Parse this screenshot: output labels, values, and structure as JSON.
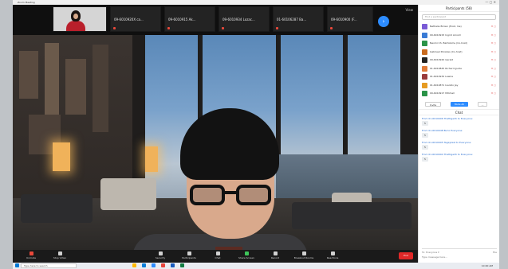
{
  "window": {
    "title": "Zoom Meeting",
    "controls": "— ▢ ✕"
  },
  "thumbnails": [
    {
      "name": ""
    },
    {
      "name": "09-6010920X ca..."
    },
    {
      "name": "09-6010915 Ak..."
    },
    {
      "name": "09-6010934 Lozac..."
    },
    {
      "name": "01-60106287 Ba..."
    },
    {
      "name": "09-6010900 (F..."
    }
  ],
  "view_label": "View",
  "toolbar": {
    "items": [
      {
        "label": "Unmute",
        "icon": "microphone-icon"
      },
      {
        "label": "Stop Video",
        "icon": "video-icon"
      },
      {
        "label": "Security",
        "icon": "shield-icon"
      },
      {
        "label": "Participants",
        "icon": "participants-icon"
      },
      {
        "label": "Chat",
        "icon": "chat-icon"
      },
      {
        "label": "Share Screen",
        "icon": "share-screen-icon"
      },
      {
        "label": "Record",
        "icon": "record-icon"
      },
      {
        "label": "Breakout Rooms",
        "icon": "breakout-rooms-icon"
      },
      {
        "label": "Reactions",
        "icon": "reactions-icon"
      }
    ],
    "end_label": "End"
  },
  "participants_panel": {
    "title": "Participants (58)",
    "search_placeholder": "Find a participant",
    "rows": [
      {
        "name": "Nathalie Brown (Host, me)",
        "status": "✕ ▢",
        "color": "#7a5bd6"
      },
      {
        "name": "09-6010915 Ingrid Arnold",
        "status": "✕ ▢",
        "color": "#3a7bd5"
      },
      {
        "name": "Naomi Ch. Bartolome (Co-host)",
        "status": "✕ ▢",
        "color": "#2b9348"
      },
      {
        "name": "Gabrieel Ponsiles (Co-host)",
        "status": "✕ ▢",
        "color": "#c96b1f"
      },
      {
        "name": "09-6010920 Gerald",
        "status": "✕ ▢",
        "color": "#222222"
      },
      {
        "name": "01-6010845 Richard guide",
        "status": "✕ ▢",
        "color": "#e07b39"
      },
      {
        "name": "01-6010932 Lawrie",
        "status": "✕ ▢",
        "color": "#9a3b3b"
      },
      {
        "name": "01-6010871 Ivanillo Jay",
        "status": "✕ ▢",
        "color": "#e69b22"
      },
      {
        "name": "09-6010917 Mitchell",
        "status": "✕ ▢",
        "color": "#2b9348"
      }
    ],
    "invite_label": "Invite",
    "mute_all_label": "Mute All",
    "more_label": "..."
  },
  "chat_panel": {
    "title": "Chat",
    "messages": [
      {
        "from": "From 01-6010906 Thattigadh to Everyone:",
        "text": "5"
      },
      {
        "from": "From 01-6010948 Bs to Everyone:",
        "text": "5"
      },
      {
        "from": "From 01-6010905 Tagaytest to Everyone:",
        "text": "5"
      },
      {
        "from": "From 01-6010904 Thattigadh to Everyone:",
        "text": "5"
      }
    ],
    "to_label": "To: Everyone ▾",
    "file_label": "File",
    "input_placeholder": "Type message here..."
  },
  "taskbar": {
    "search_placeholder": "Type here to search",
    "clock": "10:00 AM"
  }
}
